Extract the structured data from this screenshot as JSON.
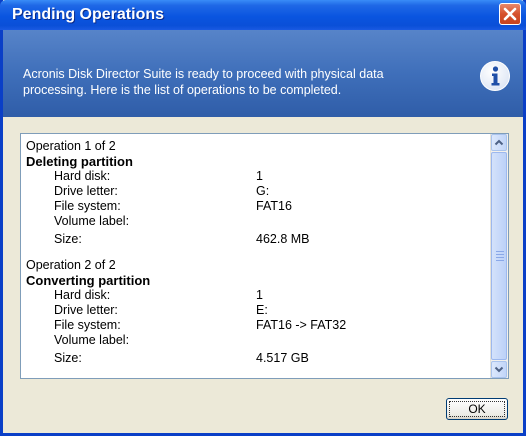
{
  "window": {
    "title": "Pending Operations"
  },
  "header": {
    "text": "Acronis Disk Director Suite is ready to proceed with physical data processing. Here is the list of operations to be completed."
  },
  "operations": [
    {
      "header": "Operation 1 of 2",
      "title": "Deleting partition",
      "fields": [
        {
          "label": "Hard disk:",
          "value": "1"
        },
        {
          "label": "Drive letter:",
          "value": "G:"
        },
        {
          "label": "File system:",
          "value": "FAT16"
        },
        {
          "label": "Volume label:",
          "value": ""
        },
        {
          "label": "Size:",
          "value": "462.8 MB"
        }
      ]
    },
    {
      "header": "Operation 2 of 2",
      "title": "Converting partition",
      "fields": [
        {
          "label": "Hard disk:",
          "value": "1"
        },
        {
          "label": "Drive letter:",
          "value": "E:"
        },
        {
          "label": "File system:",
          "value": "FAT16 -> FAT32"
        },
        {
          "label": "Volume label:",
          "value": ""
        },
        {
          "label": "Size:",
          "value": "4.517 GB"
        }
      ]
    }
  ],
  "buttons": {
    "ok": "OK"
  },
  "colors": {
    "title_bar": "#0a55e0",
    "header_band": "#3f6fba",
    "close_button": "#d6512d",
    "dialog_bg": "#ece9d8"
  },
  "icons": [
    "close-icon",
    "info-icon",
    "scroll-up-icon",
    "scroll-down-icon"
  ]
}
